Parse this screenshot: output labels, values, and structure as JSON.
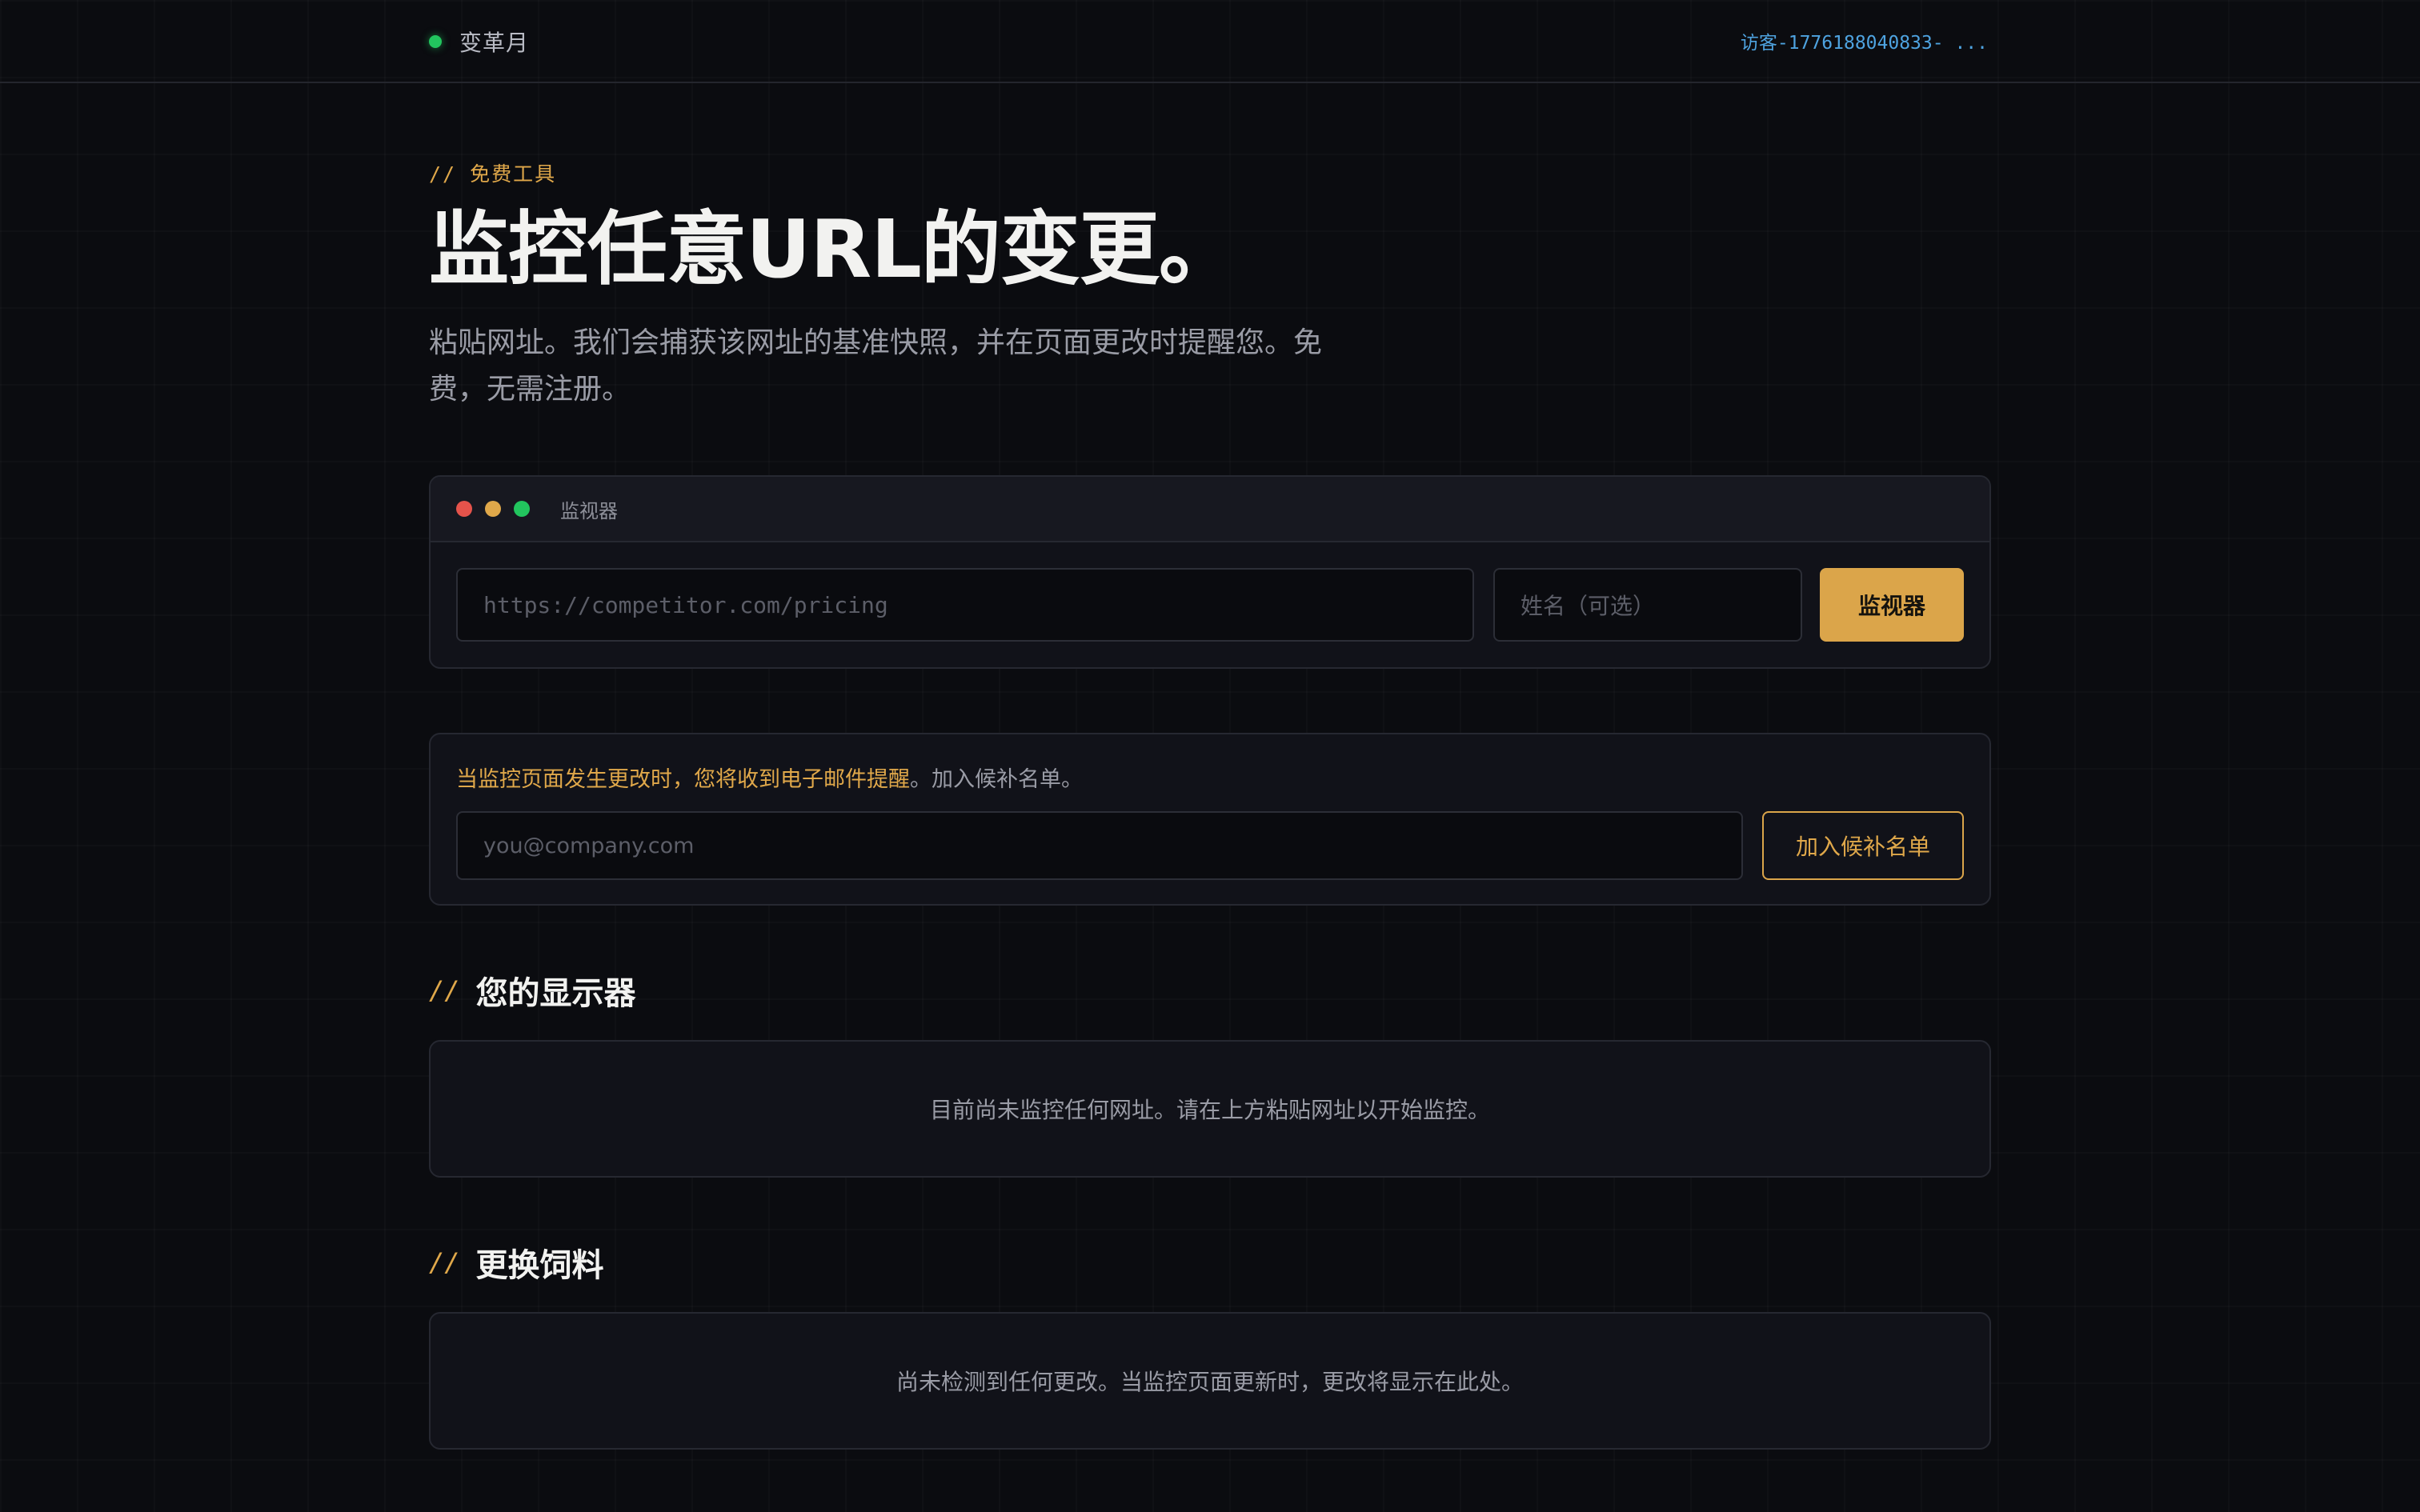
{
  "header": {
    "brand": "变革月",
    "visitor": "访客-1776188040833- ..."
  },
  "hero": {
    "kicker": "// 免费工具",
    "title": "监控任意URL的变更。",
    "subtitle": "粘贴网址。我们会捕获该网址的基准快照，并在页面更改时提醒您。免费，无需注册。"
  },
  "monitor_panel": {
    "title": "监视器",
    "url_placeholder": "https://competitor.com/pricing",
    "name_placeholder": "姓名（可选）",
    "submit_label": "监视器"
  },
  "waitlist": {
    "highlight": "当监控页面发生更改时，您将收到电子邮件提醒",
    "rest": "。加入候补名单。",
    "email_placeholder": "you@company.com",
    "button_label": "加入候补名单"
  },
  "monitors_section": {
    "slashes": "//",
    "title": "您的显示器",
    "empty_text": "目前尚未监控任何网址。请在上方粘贴网址以开始监控。"
  },
  "feed_section": {
    "slashes": "//",
    "title": "更换饲料",
    "empty_text": "尚未检测到任何更改。当监控页面更新时，更改将显示在此处。"
  },
  "colors": {
    "accent": "#dba54a",
    "status_green": "#22c55e",
    "link_blue": "#4ea3e0",
    "background": "#0b0c10"
  }
}
